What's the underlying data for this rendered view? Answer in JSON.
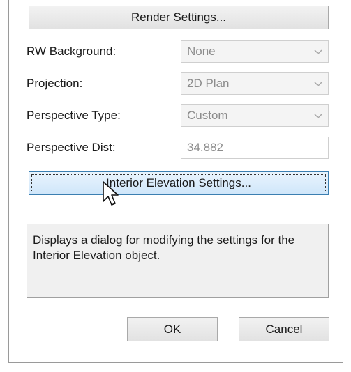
{
  "buttons": {
    "render_settings": "Render Settings...",
    "interior_elevation_settings": "Interior Elevation Settings...",
    "ok": "OK",
    "cancel": "Cancel"
  },
  "fields": [
    {
      "label": "RW Background:",
      "value": "None",
      "type": "select"
    },
    {
      "label": "Projection:",
      "value": "2D Plan",
      "type": "select"
    },
    {
      "label": "Perspective Type:",
      "value": "Custom",
      "type": "select"
    },
    {
      "label": "Perspective Dist:",
      "value": "34.882",
      "type": "text"
    }
  ],
  "description": "Displays a dialog for modifying the settings for the Interior Elevation object.",
  "icons": {
    "dropdown": "chevron-down-icon",
    "cursor": "mouse-pointer-icon"
  },
  "colors": {
    "focused_button_border": "#3c7fb1",
    "focused_button_fill": "#cfe6fa",
    "disabled_text": "#8c8c8c"
  }
}
